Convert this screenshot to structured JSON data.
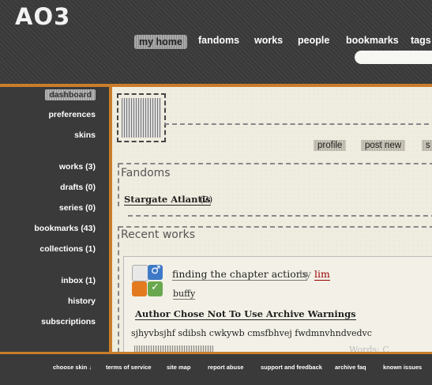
{
  "site": {
    "logo": "AO3"
  },
  "nav": [
    "my home",
    "fandoms",
    "works",
    "people",
    "bookmarks",
    "tags"
  ],
  "sidebar": {
    "items": [
      "dashboard",
      "preferences",
      "skins",
      "works (3)",
      "drafts (0)",
      "series (0)",
      "bookmarks (43)",
      "collections (1)",
      "inbox (1)",
      "history",
      "subscriptions"
    ]
  },
  "actions": [
    "profile",
    "post new",
    "s"
  ],
  "fandoms": {
    "heading": "Fandoms",
    "items": [
      {
        "name": "Stargate Atlantis",
        "count": "(2)"
      }
    ]
  },
  "recent": {
    "heading": "Recent works",
    "work": {
      "title": "finding the chapter actions",
      "by": "by",
      "author": "lim",
      "fandom": "buffy",
      "warning": "Author Chose Not To Use Archive Warnings",
      "summary": "sjhyvbsjhf sdibsh cwkywb cmsfbhvej fwdmnvhndvedvc",
      "faint_text": "Words:   C"
    }
  },
  "footer": [
    "choose skin ↓",
    "terms of service",
    "site map",
    "report abuse",
    "support and feedback",
    "archive faq",
    "known issues"
  ],
  "colors": {
    "accent": "#c97d2b",
    "author": "#990000",
    "background": "#3a3a3a",
    "paper": "#efece0"
  }
}
